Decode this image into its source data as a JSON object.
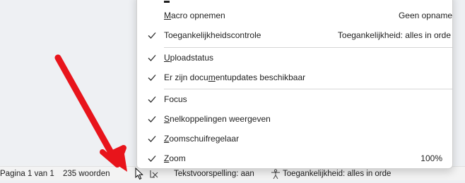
{
  "status_bar": {
    "page": "Pagina 1 van 1",
    "words": "235 woorden",
    "proofing": "Tekstvoorspelling: aan",
    "accessibility": "Toegankelijkheid: alles in orde"
  },
  "context_menu": {
    "items": [
      {
        "pre": "",
        "u": "M",
        "post": "acro opnemen",
        "value": "Geen opname",
        "checked": false
      },
      {
        "pre": "",
        "u": "",
        "post": "Toegankelijkheidscontrole",
        "value": "Toegankelijkheid: alles in orde",
        "checked": true
      },
      {
        "pre": "",
        "u": "U",
        "post": "ploadstatus",
        "value": "",
        "checked": true
      },
      {
        "pre": "Er zijn docu",
        "u": "m",
        "post": "entupdates beschikbaar",
        "value": "",
        "checked": true
      },
      {
        "pre": "",
        "u": "",
        "post": "Focus",
        "value": "",
        "checked": true
      },
      {
        "pre": "",
        "u": "S",
        "post": "nelkoppelingen weergeven",
        "value": "",
        "checked": true
      },
      {
        "pre": "",
        "u": "Z",
        "post": "oomschuifregelaar",
        "value": "",
        "checked": true
      },
      {
        "pre": "",
        "u": "Z",
        "post": "oom",
        "value": "100%",
        "checked": true
      }
    ]
  },
  "colors": {
    "background": "#eef0f3",
    "menu_background": "#ffffff",
    "arrow": "#e8141b",
    "status_bar": "#f3f3f3"
  },
  "icons": {
    "check": "checkmark-icon",
    "proofing": "proofing-icon",
    "accessibility": "accessibility-icon",
    "cursor": "mouse-cursor-icon"
  }
}
